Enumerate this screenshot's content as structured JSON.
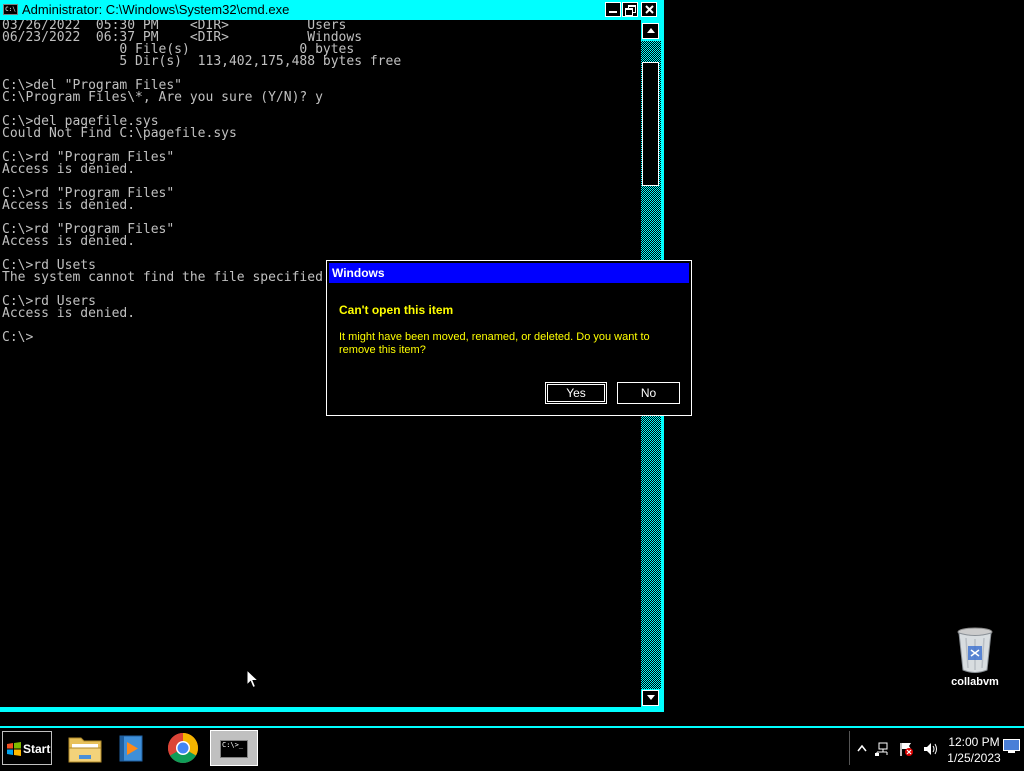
{
  "cmd_window": {
    "title": "Administrator: C:\\Windows\\System32\\cmd.exe",
    "icon_text": "C:\\",
    "console_lines": [
      "03/26/2022  05:30 PM    <DIR>          Users",
      "06/23/2022  06:37 PM    <DIR>          Windows",
      "               0 File(s)              0 bytes",
      "               5 Dir(s)  113,402,175,488 bytes free",
      "",
      "C:\\>del \"Program Files\"",
      "C:\\Program Files\\*, Are you sure (Y/N)? y",
      "",
      "C:\\>del pagefile.sys",
      "Could Not Find C:\\pagefile.sys",
      "",
      "C:\\>rd \"Program Files\"",
      "Access is denied.",
      "",
      "C:\\>rd \"Program Files\"",
      "Access is denied.",
      "",
      "C:\\>rd \"Program Files\"",
      "Access is denied.",
      "",
      "C:\\>rd Usets",
      "The system cannot find the file specified.",
      "",
      "C:\\>rd Users",
      "Access is denied.",
      "",
      "C:\\>"
    ]
  },
  "dialog": {
    "title": "Windows",
    "heading": "Can't open this item",
    "message": "It might have been moved, renamed, or deleted. Do you want to remove this item?",
    "yes_label": "Yes",
    "no_label": "No"
  },
  "desktop": {
    "recycle_bin_label": "collabvm"
  },
  "taskbar": {
    "start_label": "Start",
    "cmd_icon_text": "C:\\>_",
    "clock_time": "12:00 PM",
    "clock_date": "1/25/2023",
    "pinned": [
      "file-explorer-icon",
      "media-player-icon",
      "chrome-icon",
      "cmd-icon"
    ]
  },
  "colors": {
    "window_frame": "#00ffff",
    "console_text": "#c0c0c0",
    "dialog_titlebar": "#0000ff",
    "dialog_text": "#ffff00"
  }
}
